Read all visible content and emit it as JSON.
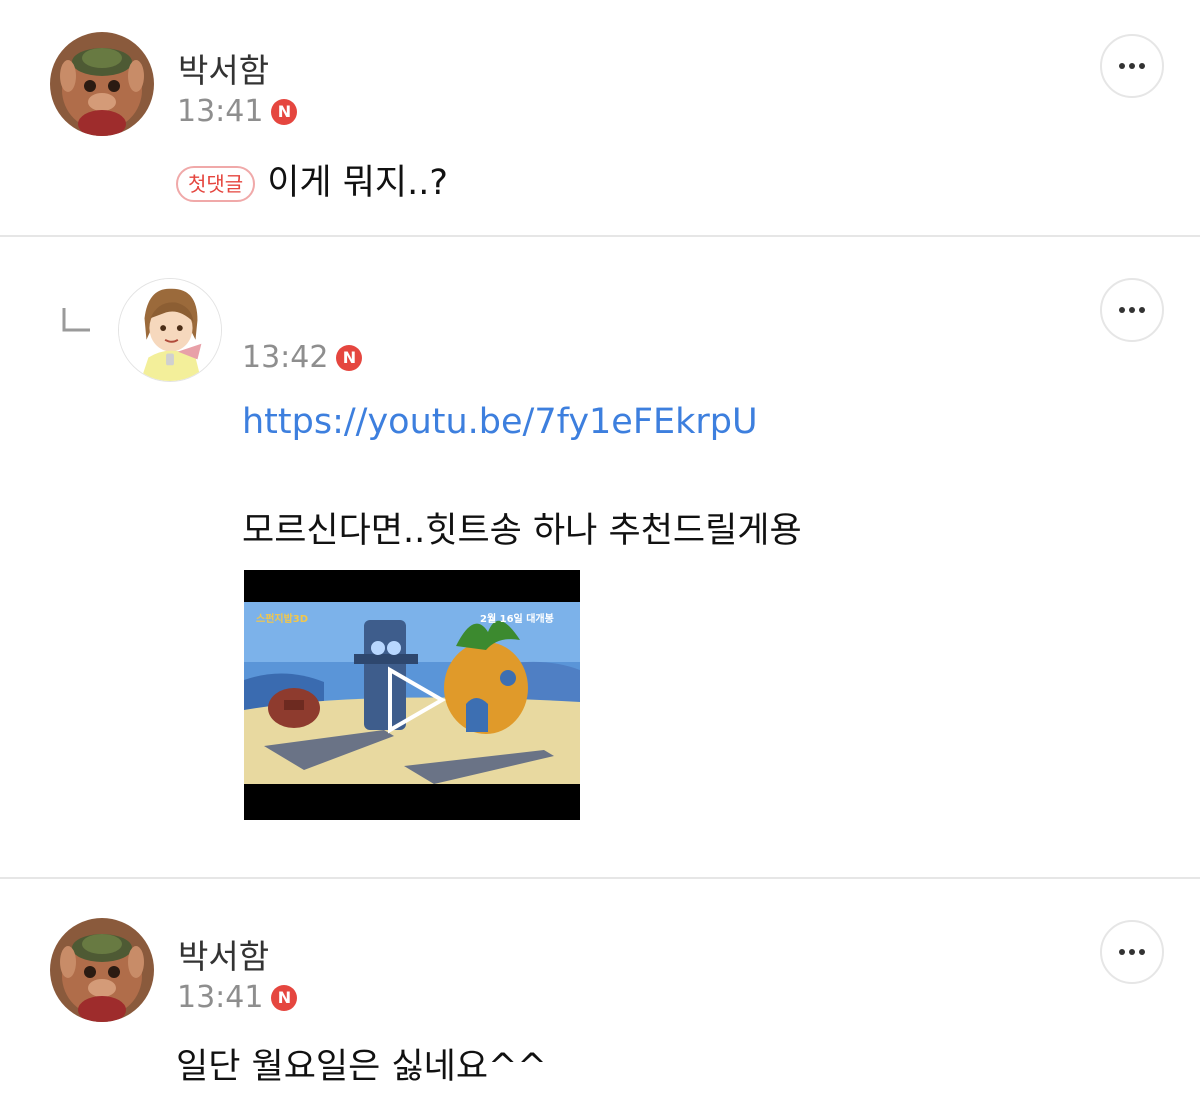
{
  "comments": [
    {
      "author": "박서함",
      "time": "13:41",
      "badge": "N",
      "tag": "첫댓글",
      "text": "이게 뭐지..?"
    },
    {
      "author": "",
      "time": "13:42",
      "badge": "N",
      "link": "https://youtu.be/7fy1eFEkrpU",
      "text": "모르신다면..힛트송 하나 추천드릴게용",
      "video": {
        "overlay_left": "스펀지밥3D",
        "overlay_right": "2월 16일 대개봉"
      }
    },
    {
      "author": "박서함",
      "time": "13:41",
      "badge": "N",
      "text": "일단 월요일은 싫네요^^"
    }
  ],
  "colors": {
    "accent_red": "#e5463f",
    "link_blue": "#3d7fde",
    "time_gray": "#8e8e8e",
    "divider": "#e6e6e6"
  },
  "icons": {
    "more": "more-options-icon",
    "reply": "reply-arrow-icon",
    "play": "play-icon"
  }
}
